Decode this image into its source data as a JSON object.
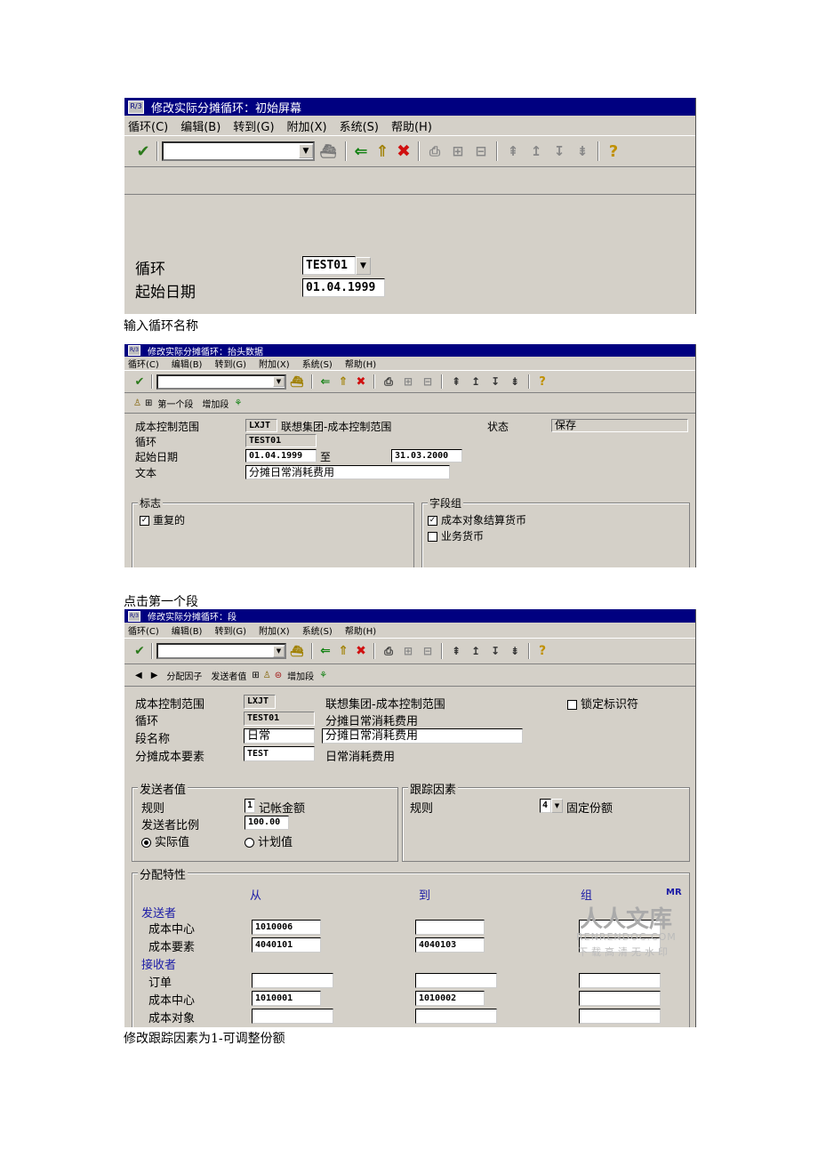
{
  "screen1": {
    "title": "修改实际分摊循环：初始屏幕",
    "menu": [
      "循环(C)",
      "编辑(B)",
      "转到(G)",
      "附加(X)",
      "系统(S)",
      "帮助(H)"
    ],
    "cycle_label": "循环",
    "cycle_value": "TEST01",
    "start_date_label": "起始日期",
    "start_date_value": "01.04.1999"
  },
  "caption1": "输入循环名称",
  "screen2": {
    "title": "修改实际分摊循环：抬头数据",
    "menu": [
      "循环(C)",
      "编辑(B)",
      "转到(G)",
      "附加(X)",
      "系统(S)",
      "帮助(H)"
    ],
    "app_toolbar": {
      "first_segment": "第一个段",
      "add_segment": "增加段"
    },
    "controlling_area_label": "成本控制范围",
    "controlling_area_code": "LXJT",
    "controlling_area_name": "联想集团-成本控制范围",
    "status_label": "状态",
    "status_value": "保存",
    "cycle_label": "循环",
    "cycle_value": "TEST01",
    "start_date_label": "起始日期",
    "start_date_value": "01.04.1999",
    "to_label": "至",
    "end_date_value": "31.03.2000",
    "text_label": "文本",
    "text_value": "分摊日常消耗费用",
    "flags_group": "标志",
    "repeat_label": "重复的",
    "field_group": "字段组",
    "cost_object_currency_label": "成本对象结算货币",
    "business_currency_label": "业务货币"
  },
  "caption2": "点击第一个段",
  "screen3": {
    "title": "修改实际分摊循环：段",
    "menu": [
      "循环(C)",
      "编辑(B)",
      "转到(G)",
      "附加(X)",
      "系统(S)",
      "帮助(H)"
    ],
    "app_toolbar": {
      "alloc_factor": "分配因子",
      "sender_values": "发送者值",
      "add_segment": "增加段"
    },
    "controlling_area_label": "成本控制范围",
    "controlling_area_code": "LXJT",
    "controlling_area_name": "联想集团-成本控制范围",
    "lock_indicator_label": "锁定标识符",
    "cycle_label": "循环",
    "cycle_value": "TEST01",
    "cycle_text": "分摊日常消耗费用",
    "segment_name_label": "段名称",
    "segment_name_value": "日常",
    "segment_text": "分摊日常消耗费用",
    "alloc_cost_element_label": "分摊成本要素",
    "alloc_cost_element_value": "TEST",
    "alloc_cost_element_text": "日常消耗费用",
    "sender_values_group": "发送者值",
    "rule_label": "规则",
    "sender_rule_value": "1",
    "sender_rule_text": "记帐金额",
    "sender_percentage_label": "发送者比例",
    "sender_percentage_value": "100.00",
    "actual_value_label": "实际值",
    "plan_value_label": "计划值",
    "tracing_factor_group": "跟踪因素",
    "tracing_rule_label": "规则",
    "tracing_rule_value": "4",
    "tracing_rule_text": "固定份额",
    "alloc_char_group": "分配特性",
    "from_header": "从",
    "to_header": "到",
    "group_header": "组",
    "mr_header": "MR",
    "sender_section": "发送者",
    "sender_cost_center_label": "成本中心",
    "sender_cost_center_from": "1010006",
    "sender_cost_element_label": "成本要素",
    "sender_cost_element_from": "4040101",
    "sender_cost_element_to": "4040103",
    "receiver_section": "接收者",
    "order_label": "订单",
    "receiver_cost_center_label": "成本中心",
    "receiver_cost_center_from": "1010001",
    "receiver_cost_center_to": "1010002",
    "cost_object_label": "成本对象"
  },
  "watermark": {
    "main": "人人文库",
    "url": "RENRENDOC.COM",
    "sub": "下载高清无水印"
  },
  "caption3": "修改跟踪因素为1-可调整份额"
}
